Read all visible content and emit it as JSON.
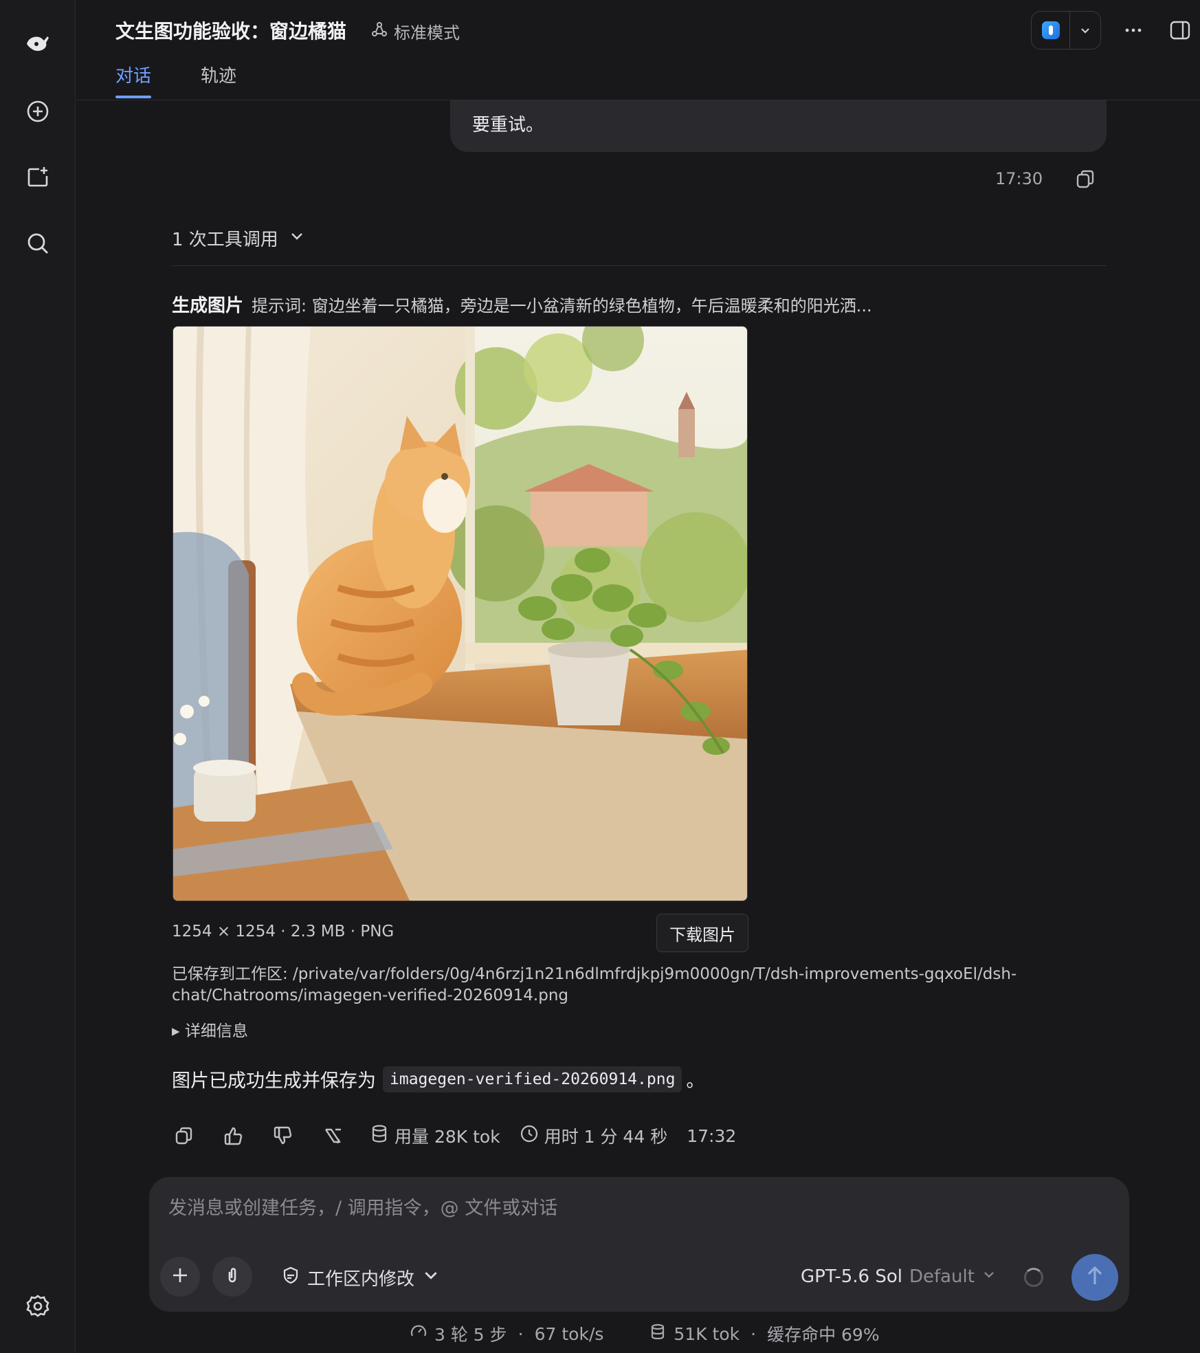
{
  "header": {
    "title": "文生图功能验收：窗边橘猫",
    "mode": "标准模式",
    "tabs": [
      {
        "label": "对话",
        "active": true
      },
      {
        "label": "轨迹",
        "active": false
      }
    ]
  },
  "user_message": {
    "visible_text": "要重试。",
    "time": "17:30"
  },
  "assistant": {
    "tool_calls_label": "1 次工具调用",
    "tool_name": "生成图片",
    "prompt_line": "提示词: 窗边坐着一只橘猫，旁边是一小盆清新的绿色植物，午后温暖柔和的阳光洒...",
    "image_meta": "1254 × 1254 · 2.3 MB · PNG",
    "download_label": "下载图片",
    "saved_path": "已保存到工作区: /private/var/folders/0g/4n6rzj1n21n6dlmfrdjkpj9m0000gn/T/dsh-improvements-gqxoEl/dsh-chat/Chatrooms/imagegen-verified-20260914.png",
    "details_label": "▸ 详细信息",
    "result_prefix": "图片已成功生成并保存为",
    "result_file": "imagegen-verified-20260914.png",
    "result_suffix": "。",
    "usage": "用量 28K tok",
    "duration": "用时 1 分 44 秒",
    "time": "17:32"
  },
  "composer": {
    "placeholder": "发消息或创建任务，/ 调用指令，@ 文件或对话",
    "workspace_mode": "工作区内修改",
    "model": "GPT-5.6 Sol",
    "model_variant": "Default"
  },
  "footer": {
    "steps": "3 轮 5 步",
    "speed": "67 tok/s",
    "tokens": "51K tok",
    "cache": "缓存命中 69%"
  },
  "colors": {
    "accent": "#6f9fff",
    "background": "#18181b",
    "send_button": "#4a6fb5"
  },
  "icons": [
    "logo-icon",
    "new-chat-icon",
    "new-folder-icon",
    "search-icon",
    "settings-icon",
    "mode-icon",
    "app-icon",
    "more-icon",
    "sidebar-toggle-icon",
    "copy-icon",
    "like-icon",
    "dislike-icon",
    "branch-icon",
    "database-icon",
    "clock-icon",
    "plus-icon",
    "attach-icon",
    "shield-icon",
    "gauge-icon",
    "send-icon"
  ]
}
